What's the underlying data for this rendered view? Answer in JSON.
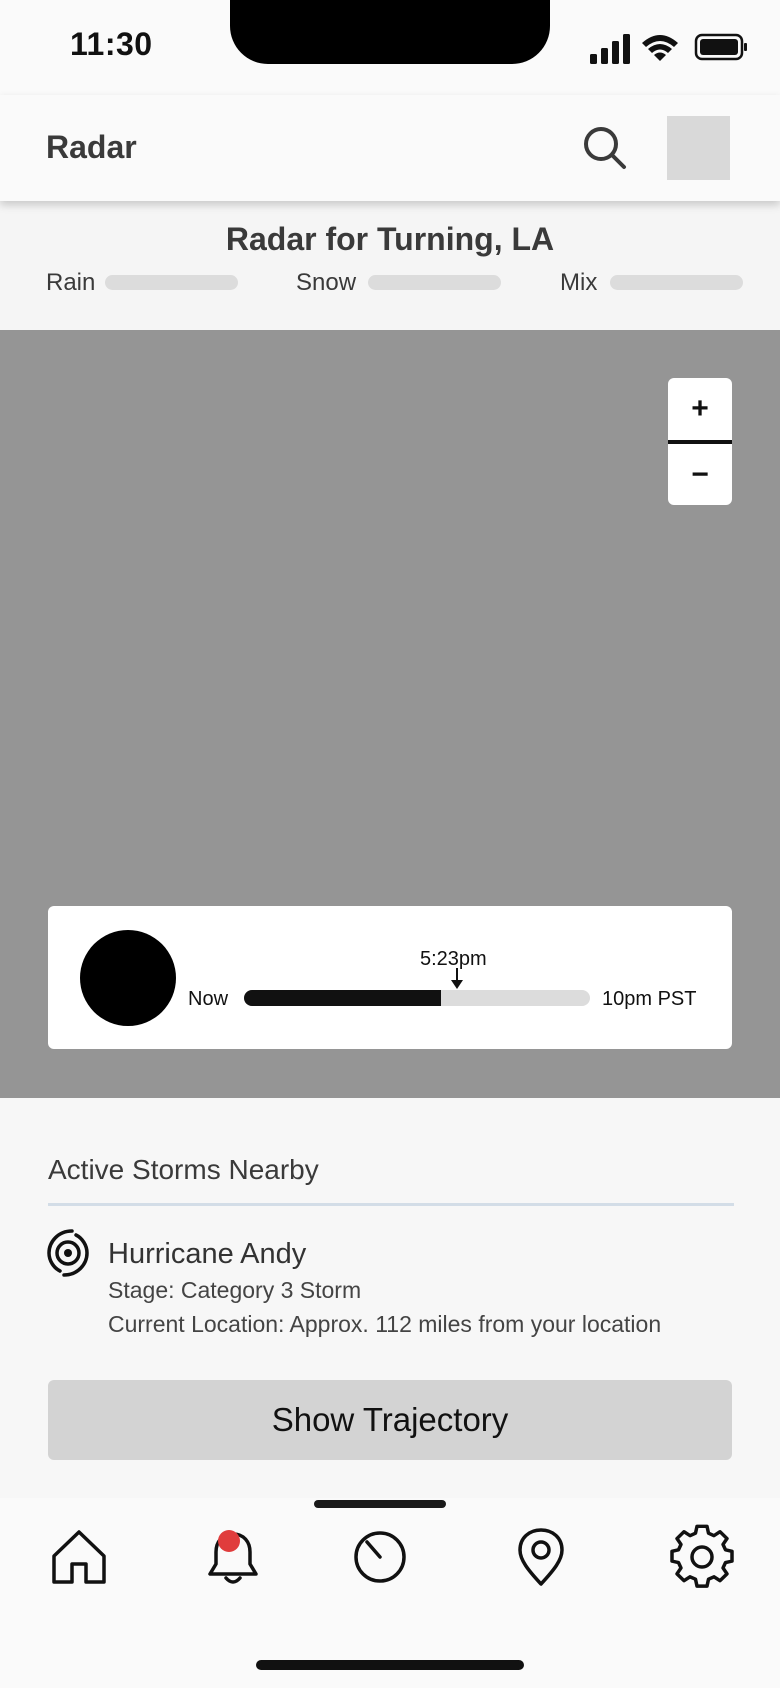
{
  "status_bar": {
    "time": "11:30"
  },
  "header": {
    "title": "Radar"
  },
  "radar": {
    "title": "Radar for Turning, LA",
    "legend": [
      {
        "label": "Rain"
      },
      {
        "label": "Snow"
      },
      {
        "label": "Mix"
      }
    ]
  },
  "map": {
    "zoom_in": "+",
    "zoom_out": "−",
    "timeline": {
      "start_label": "Now",
      "end_label": "10pm PST",
      "current_time": "5:23pm",
      "progress_fraction": 0.57
    }
  },
  "storms": {
    "title": "Active Storms Nearby",
    "items": [
      {
        "name": "Hurricane Andy",
        "stage": "Stage: Category 3 Storm",
        "location": "Current Location: Approx. 112 miles from your location"
      }
    ],
    "button_label": "Show Trajectory"
  },
  "nav": {
    "items": [
      "home-icon",
      "bell-icon",
      "radar-icon",
      "location-pin-icon",
      "gear-icon"
    ],
    "badge_color": "#e03c3c"
  }
}
